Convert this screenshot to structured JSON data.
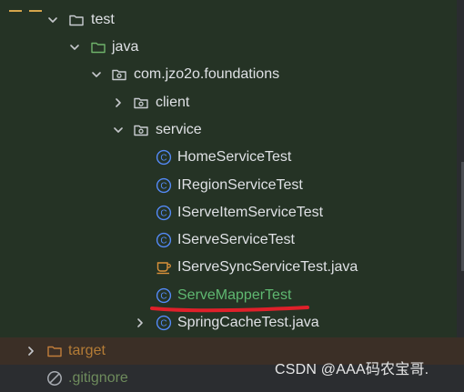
{
  "tree": {
    "items": [
      {
        "label": "test"
      },
      {
        "label": "java"
      },
      {
        "label": "com.jzo2o.foundations"
      },
      {
        "label": "client"
      },
      {
        "label": "service"
      },
      {
        "label": "HomeServiceTest"
      },
      {
        "label": "IRegionServiceTest"
      },
      {
        "label": "IServeItemServiceTest"
      },
      {
        "label": "IServeServiceTest"
      },
      {
        "label": "IServeSyncServiceTest.java"
      },
      {
        "label": "ServeMapperTest"
      },
      {
        "label": "SpringCacheTest.java"
      },
      {
        "label": "target"
      },
      {
        "label": ".gitignore"
      }
    ]
  },
  "watermark": "CSDN @AAA码农宝哥.",
  "colors": {
    "panel_bg": "#2b2d30",
    "test_scope_bg": "#253325",
    "excluded_row_bg": "#3b2f26",
    "class_icon_blue": "#548af7",
    "folder_icon": "#c9ccd1",
    "test_folder_icon": "#6fb36b",
    "excluded_folder_icon": "#c17d3a",
    "annotation_red": "#e0202a"
  }
}
